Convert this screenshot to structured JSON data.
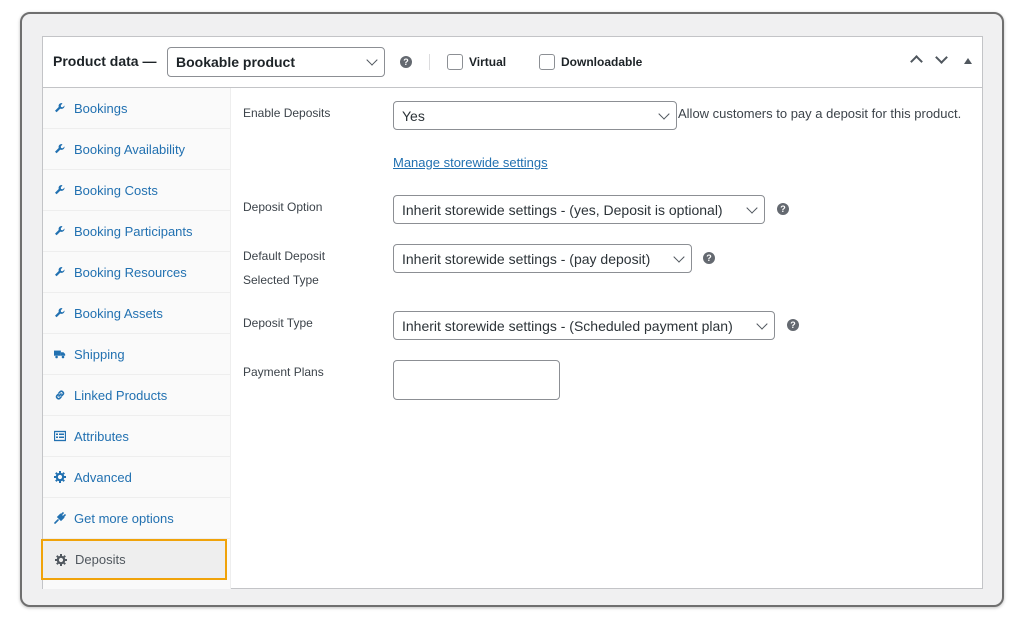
{
  "header": {
    "title": "Product data —",
    "product_type": "Bookable product",
    "virtual_label": "Virtual",
    "downloadable_label": "Downloadable",
    "help_glyph": "?"
  },
  "sidebar": {
    "items": [
      {
        "label": "Bookings",
        "icon": "wrench-icon"
      },
      {
        "label": "Booking Availability",
        "icon": "wrench-icon"
      },
      {
        "label": "Booking Costs",
        "icon": "wrench-icon"
      },
      {
        "label": "Booking Participants",
        "icon": "wrench-icon"
      },
      {
        "label": "Booking Resources",
        "icon": "wrench-icon"
      },
      {
        "label": "Booking Assets",
        "icon": "wrench-icon"
      },
      {
        "label": "Shipping",
        "icon": "truck-icon"
      },
      {
        "label": "Linked Products",
        "icon": "link-icon"
      },
      {
        "label": "Attributes",
        "icon": "list-icon"
      },
      {
        "label": "Advanced",
        "icon": "gear-icon"
      },
      {
        "label": "Get more options",
        "icon": "plugin-icon"
      },
      {
        "label": "Deposits",
        "icon": "gear-icon",
        "active": true
      }
    ]
  },
  "form": {
    "enable_deposits": {
      "label": "Enable Deposits",
      "value": "Yes",
      "description": "Allow customers to pay a deposit for this product.",
      "link": "Manage storewide settings"
    },
    "deposit_option": {
      "label": "Deposit Option",
      "value": "Inherit storewide settings - (yes, Deposit is optional)"
    },
    "default_selected_type": {
      "label_line1": "Default Deposit",
      "label_line2": "Selected Type",
      "value": "Inherit storewide settings - (pay deposit)"
    },
    "deposit_type": {
      "label": "Deposit Type",
      "value": "Inherit storewide settings - (Scheduled payment plan)"
    },
    "payment_plans": {
      "label": "Payment Plans",
      "value": ""
    }
  },
  "colors": {
    "link": "#2271b1",
    "active_outline": "#f0a30a",
    "sidebar_bg": "#fafafa"
  }
}
